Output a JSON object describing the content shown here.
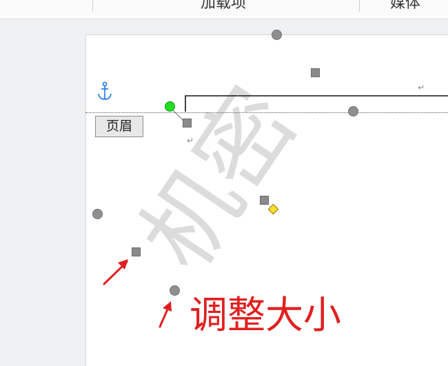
{
  "ribbon": {
    "groups": [
      {
        "label": "加载项"
      },
      {
        "label": "媒体"
      }
    ]
  },
  "document": {
    "header_tag": "页眉",
    "paragraph_mark": "↵",
    "watermark": "机密"
  },
  "annotation": {
    "text": "调整大小",
    "color": "#e02020"
  },
  "colors": {
    "rotation_handle": "#22dd22",
    "adjust_handle": "#ffe033",
    "resize_handle": "#8a8a8a",
    "anchor": "#1a73e8"
  },
  "icons": [
    "anchor-icon",
    "paragraph-mark-icon",
    "red-arrow-icon"
  ]
}
